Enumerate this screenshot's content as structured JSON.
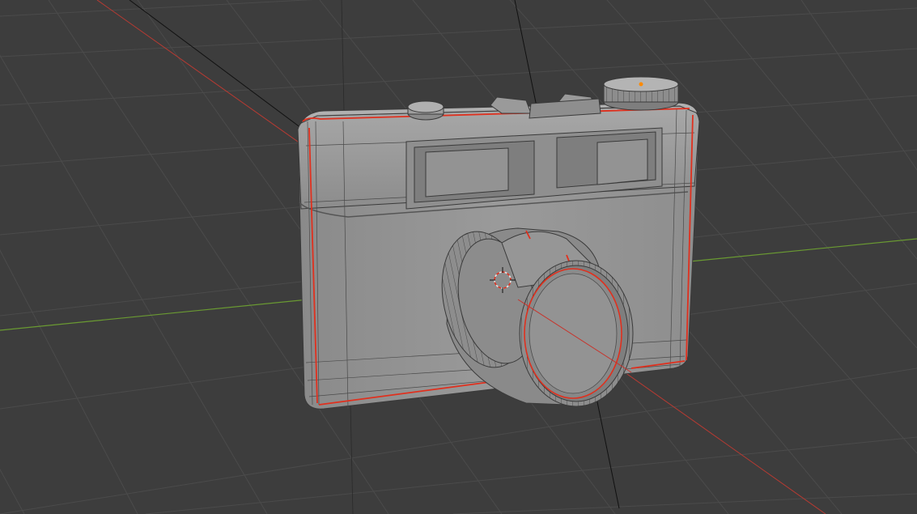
{
  "viewport": {
    "mode": "3d-viewport-edit-mode",
    "shading": "solid",
    "overlay": "wireframe",
    "object": "camera-model",
    "marked_seam_color": "#e0301e",
    "grid_color": "#4a4a4a",
    "x_axis_color": "#c8322a",
    "y_axis_color": "#6ea02e",
    "background_color": "#3d3d3d",
    "cursor": "3d-cursor-icon",
    "selected_vertex_color": "#ff8a00"
  }
}
